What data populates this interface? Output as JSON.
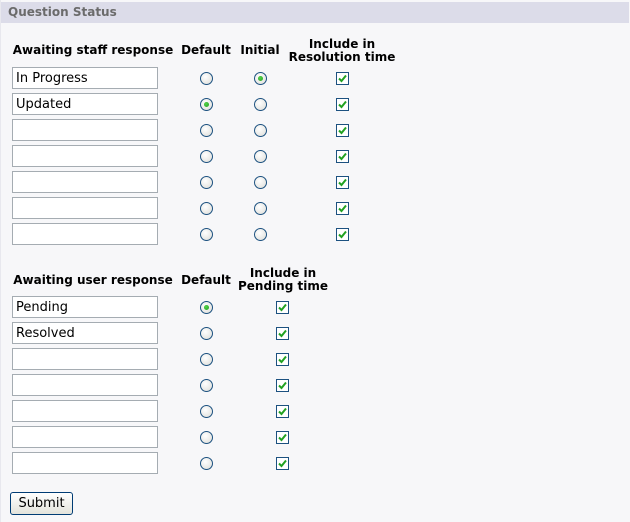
{
  "section_title": "Question Status",
  "staff_table": {
    "col_name": "Awaiting staff response",
    "col_default": "Default",
    "col_initial": "Initial",
    "col_include": "Include in Resolution time",
    "rows": [
      {
        "name": "In Progress",
        "default": false,
        "initial": true,
        "include": true
      },
      {
        "name": "Updated",
        "default": true,
        "initial": false,
        "include": true
      },
      {
        "name": "",
        "default": false,
        "initial": false,
        "include": true
      },
      {
        "name": "",
        "default": false,
        "initial": false,
        "include": true
      },
      {
        "name": "",
        "default": false,
        "initial": false,
        "include": true
      },
      {
        "name": "",
        "default": false,
        "initial": false,
        "include": true
      },
      {
        "name": "",
        "default": false,
        "initial": false,
        "include": true
      }
    ]
  },
  "user_table": {
    "col_name": "Awaiting user response",
    "col_default": "Default",
    "col_include": "Include in Pending time",
    "rows": [
      {
        "name": "Pending",
        "default": true,
        "include": true
      },
      {
        "name": "Resolved",
        "default": false,
        "include": true
      },
      {
        "name": "",
        "default": false,
        "include": true
      },
      {
        "name": "",
        "default": false,
        "include": true
      },
      {
        "name": "",
        "default": false,
        "include": true
      },
      {
        "name": "",
        "default": false,
        "include": true
      },
      {
        "name": "",
        "default": false,
        "include": true
      }
    ]
  },
  "submit_label": "Submit",
  "colors": {
    "header_bar": "#dcdce9",
    "header_text": "#6b6b6b",
    "radio_dot": "#21a121",
    "check_mark": "#21a121"
  }
}
